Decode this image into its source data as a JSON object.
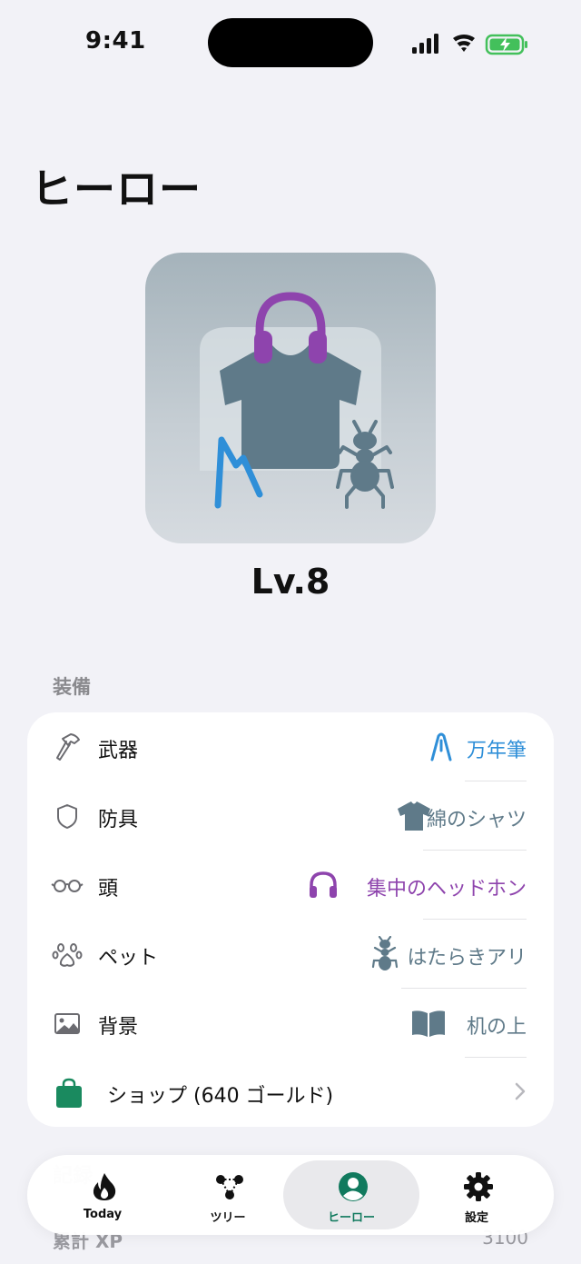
{
  "status_bar": {
    "time": "9:41"
  },
  "page": {
    "title": "ヒーロー"
  },
  "hero": {
    "level": "Lv.8"
  },
  "equipment": {
    "section_title": "装備",
    "slots": [
      {
        "label": "武器",
        "slot_icon": "hammer-icon",
        "item_name": "万年筆",
        "item_icon": "fountain-pen-icon",
        "item_color": "#2f8fd8"
      },
      {
        "label": "防具",
        "slot_icon": "shield-icon",
        "item_name": "綿のシャツ",
        "item_icon": "tshirt-icon",
        "item_color": "#5f7a89"
      },
      {
        "label": "頭",
        "slot_icon": "glasses-icon",
        "item_name": "集中のヘッドホン",
        "item_icon": "headphones-icon",
        "item_color": "#8e44ad"
      },
      {
        "label": "ペット",
        "slot_icon": "paw-icon",
        "item_name": "はたらきアリ",
        "item_icon": "ant-icon",
        "item_color": "#5f7a89"
      },
      {
        "label": "背景",
        "slot_icon": "image-icon",
        "item_name": "机の上",
        "item_icon": "book-icon",
        "item_color": "#5f7a89"
      }
    ],
    "shop": {
      "label": "ショップ (640 ゴールド)",
      "icon": "shopping-bag-icon",
      "color": "#1a8a5f"
    }
  },
  "stats": {
    "faded_heading": "記録",
    "total_xp_label": "累計 XP",
    "total_xp_value": "3100"
  },
  "tabs": [
    {
      "label": "Today",
      "icon": "flame-icon"
    },
    {
      "label": "ツリー",
      "icon": "tree-nodes-icon"
    },
    {
      "label": "ヒーロー",
      "icon": "person-circle-icon",
      "active": true
    },
    {
      "label": "設定",
      "icon": "gear-icon"
    }
  ],
  "colors": {
    "accent": "#117a5e",
    "background": "#f2f2f7"
  }
}
